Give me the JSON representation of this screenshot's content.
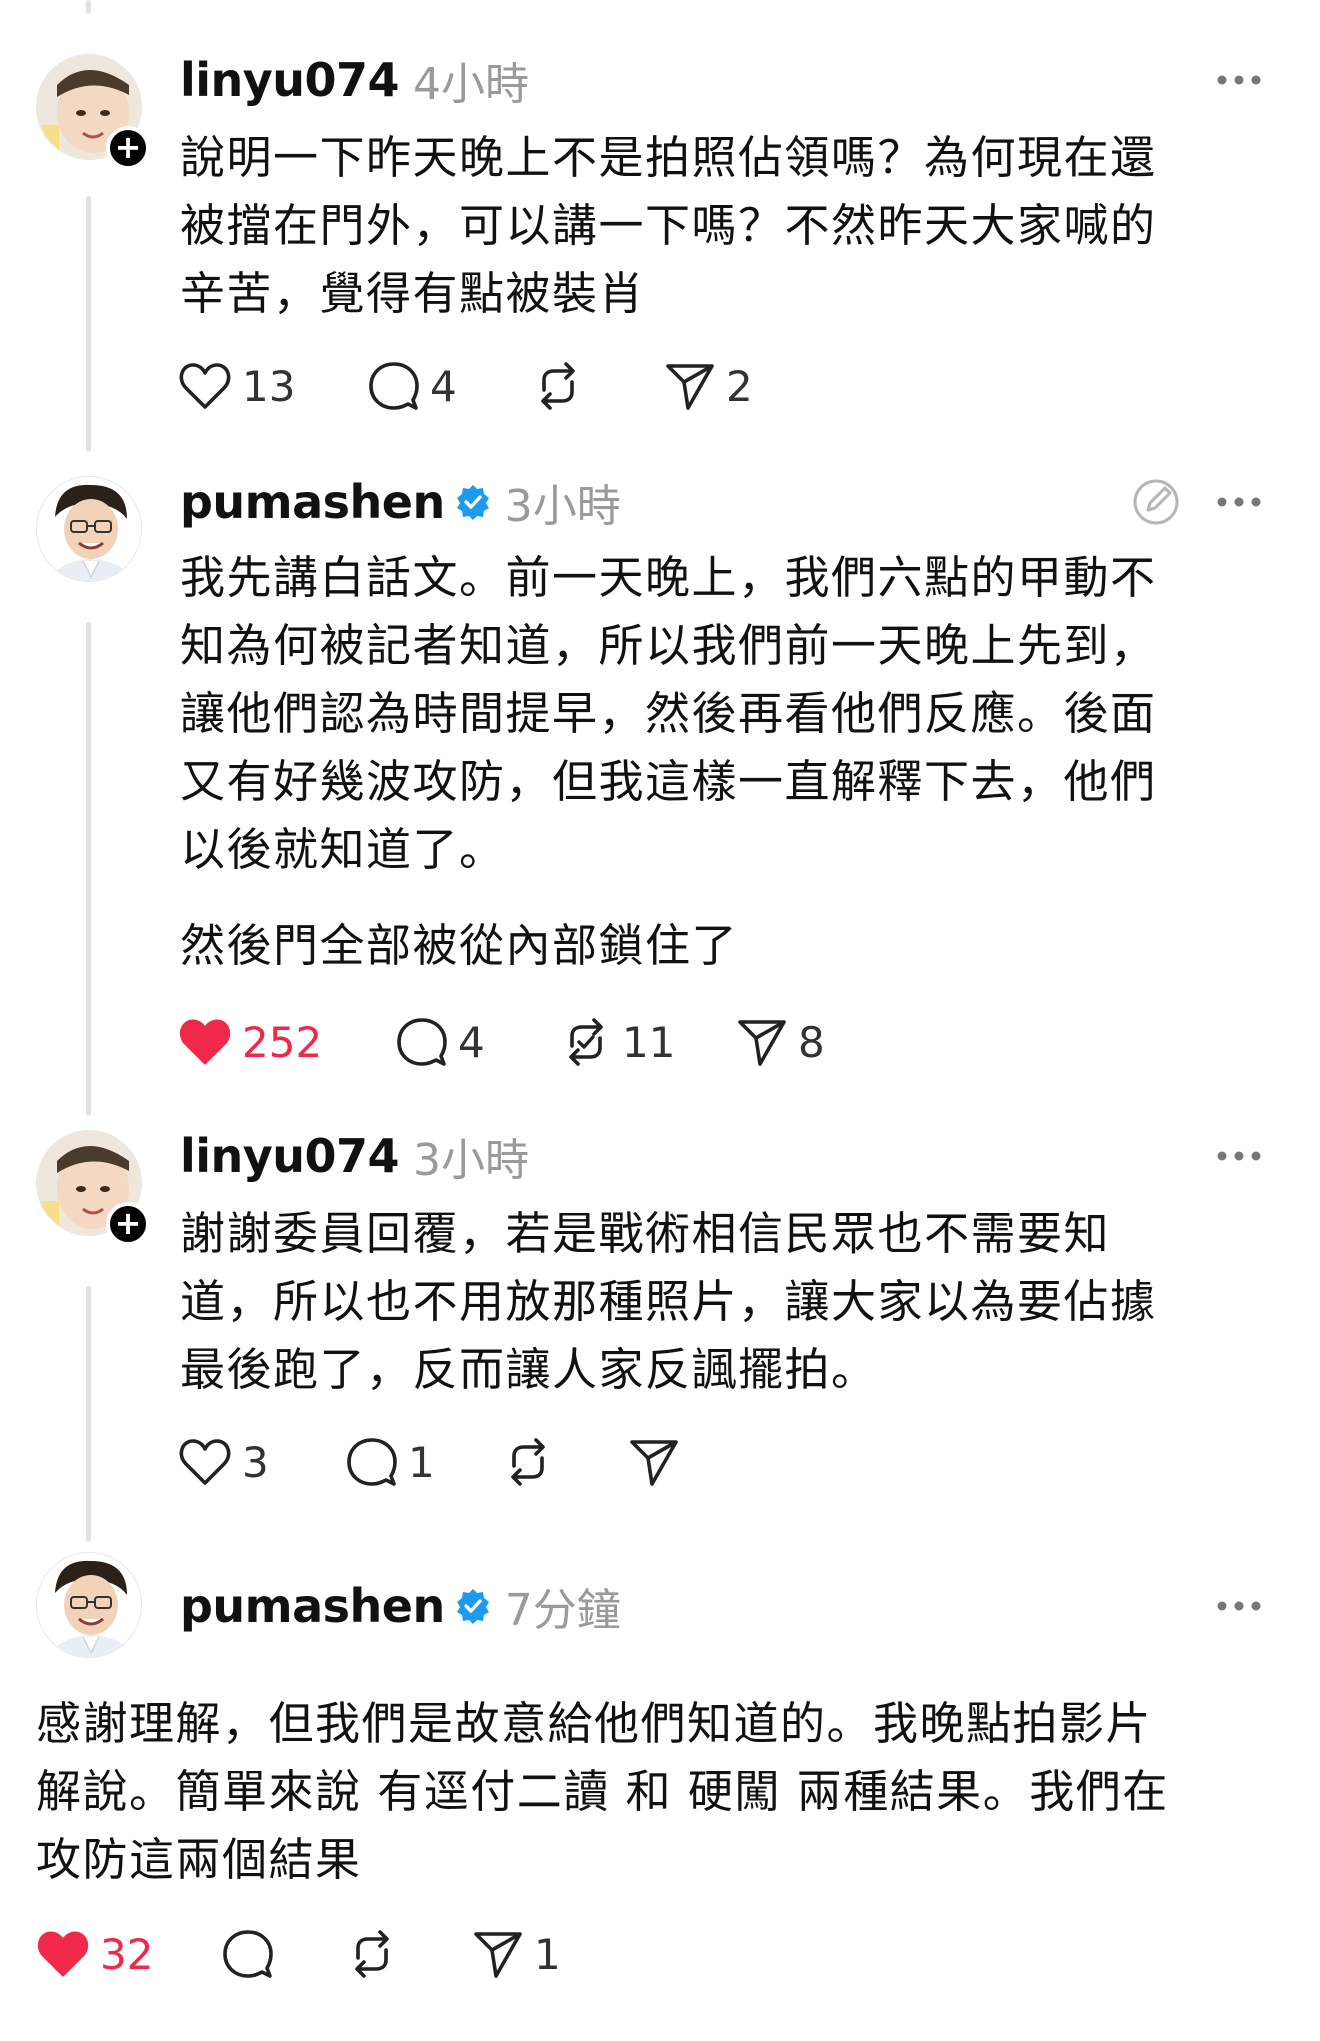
{
  "posts": [
    {
      "username": "linyu074",
      "time": "4小時",
      "text": [
        "說明一下昨天晚上不是拍照佔領嗎？為何現在還",
        "被擋在門外，可以講一下嗎？不然昨天大家喊的",
        "辛苦，覺得有點被裝肖"
      ],
      "likes": "13",
      "comments": "4",
      "reposts": "",
      "shares": "2",
      "liked": false
    },
    {
      "username": "pumashen",
      "time": "3小時",
      "text": [
        "我先講白話文。前一天晚上，我們六點的甲動不",
        "知為何被記者知道，所以我們前一天晚上先到，",
        "讓他們認為時間提早，然後再看他們反應。後面",
        "又有好幾波攻防，但我這樣一直解釋下去，他們",
        "以後就知道了。"
      ],
      "text2": "然後門全部被從內部鎖住了",
      "likes": "252",
      "comments": "4",
      "reposts": "11",
      "shares": "8",
      "liked": true
    },
    {
      "username": "linyu074",
      "time": "3小時",
      "text": [
        "謝謝委員回覆，若是戰術相信民眾也不需要知",
        "道，所以也不用放那種照片，讓大家以為要佔據",
        "最後跑了，反而讓人家反諷擺拍。"
      ],
      "likes": "3",
      "comments": "1",
      "reposts": "",
      "shares": "",
      "liked": false
    },
    {
      "username": "pumashen",
      "time": "7分鐘",
      "text": [
        "感謝理解，但我們是故意給他們知道的。我晚點拍影片",
        "解說。簡單來說 有逕付二讀 和 硬闖 兩種結果。我們在",
        "攻防這兩個結果"
      ],
      "likes": "32",
      "comments": "",
      "reposts": "",
      "shares": "1",
      "liked": true
    }
  ],
  "colors": {
    "like_active": "#f02849",
    "verified": "#1d9bf0",
    "muted": "#9a9a9a"
  },
  "icons": [
    "heart-icon",
    "comment-icon",
    "repost-icon",
    "share-icon",
    "more-icon",
    "edit-icon",
    "verified-icon",
    "follow-plus-icon"
  ]
}
